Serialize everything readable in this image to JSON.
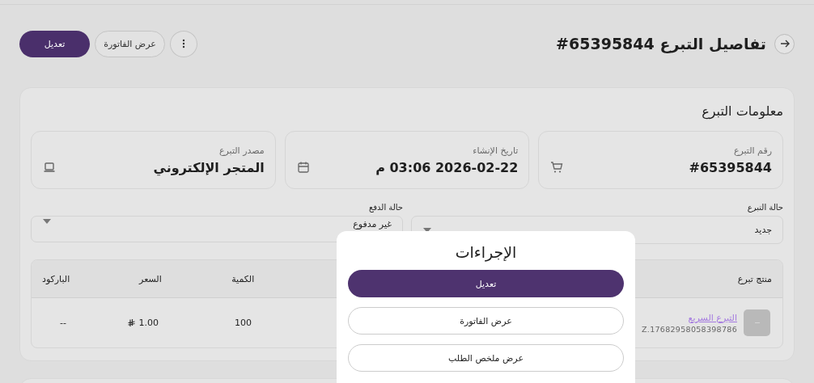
{
  "header": {
    "title": "تفاصيل التبرع 65395844#",
    "buttons": [
      {
        "label": "عرض الفاتورة",
        "kind": "outline"
      },
      {
        "label": "تعديل",
        "kind": "primary"
      }
    ]
  },
  "info": {
    "title": "معلومات التبرع",
    "fields": [
      {
        "label": "رقم التبرع",
        "value": "#65395844"
      },
      {
        "label": "تاريخ الإنشاء",
        "value": "2026-02-22 03:06 م"
      },
      {
        "label": "مصدر التبرع",
        "value": "المتجر الإلكتروني"
      }
    ],
    "selects": [
      {
        "label": "حالة التبرع",
        "value": "جديد"
      },
      {
        "label": "حالة الدفع",
        "value": "غير مدفوع"
      }
    ],
    "table": {
      "columns": [
        "منتج تبرع",
        "الكمية",
        "السعر",
        "الباركود"
      ],
      "rows": [
        {
          "product": "التبرع السريع",
          "sku": "Z.17682958058398786",
          "quantity": "100",
          "price": "1.00",
          "barcode": "--"
        }
      ]
    }
  },
  "actions": {
    "title": "الإجراءات",
    "buttons": [
      {
        "label": "تعديل",
        "kind": "primary"
      },
      {
        "label": "عرض الفاتورة",
        "kind": "outline"
      },
      {
        "label": "عرض ملخص الطلب",
        "kind": "outline"
      }
    ]
  }
}
